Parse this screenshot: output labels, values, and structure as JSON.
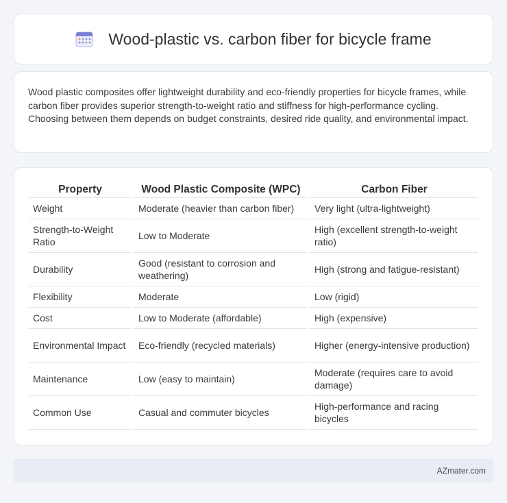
{
  "header": {
    "title": "Wood-plastic vs. carbon fiber for bicycle frame",
    "icon": "calendar-grid-icon",
    "icon_color": "#7b7fd6"
  },
  "intro": {
    "text": "Wood plastic composites offer lightweight durability and eco-friendly properties for bicycle frames, while carbon fiber provides superior strength-to-weight ratio and stiffness for high-performance cycling. Choosing between them depends on budget constraints, desired ride quality, and environmental impact."
  },
  "table": {
    "headers": [
      "Property",
      "Wood Plastic Composite (WPC)",
      "Carbon Fiber"
    ],
    "rows": [
      [
        "Weight",
        "Moderate (heavier than carbon fiber)",
        "Very light (ultra-lightweight)"
      ],
      [
        "Strength-to-Weight Ratio",
        "Low to Moderate",
        "High (excellent strength-to-weight ratio)"
      ],
      [
        "Durability",
        "Good (resistant to corrosion and weathering)",
        "High (strong and fatigue-resistant)"
      ],
      [
        "Flexibility",
        "Moderate",
        "Low (rigid)"
      ],
      [
        "Cost",
        "Low to Moderate (affordable)",
        "High (expensive)"
      ],
      [
        "Environmental Impact",
        "Eco-friendly (recycled materials)",
        "Higher (energy-intensive production)"
      ],
      [
        "Maintenance",
        "Low (easy to maintain)",
        "Moderate (requires care to avoid damage)"
      ],
      [
        "Common Use",
        "Casual and commuter bicycles",
        "High-performance and racing bicycles"
      ]
    ]
  },
  "footer": {
    "text": "AZmater.com"
  }
}
